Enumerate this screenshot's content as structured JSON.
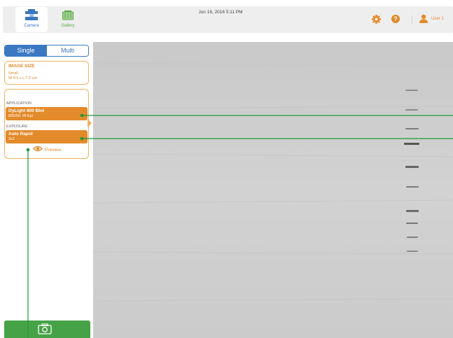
{
  "topbar": {
    "camera_label": "Camera",
    "gallery_label": "Gallery",
    "datetime": "Jun 16, 2016  5:11 PM",
    "user_label": "User 1",
    "help_glyph": "?"
  },
  "mode": {
    "single_label": "Single",
    "multi_label": "Multi",
    "selected": "Single"
  },
  "image_size": {
    "heading": "IMAGE SIZE",
    "size": "Small",
    "dimensions": "W 9.5 x L 7.6 cm"
  },
  "application": {
    "heading": "APPLICATION",
    "value": "DyLight 800 Blot",
    "detail": "835/50, IR Epi"
  },
  "exposure": {
    "heading": "EXPOSURE",
    "value": "Auto Rapid",
    "detail": "2x2"
  },
  "preview": {
    "label": "Preview"
  },
  "colors": {
    "accent_blue": "#3a78c2",
    "accent_orange": "#e38a2a",
    "accent_green": "#46a246",
    "callout_green": "#1a9a3a"
  },
  "icons": [
    "camera-mode-icon",
    "gallery-icon",
    "gear-icon",
    "help-icon",
    "user-icon",
    "eye-icon",
    "camera-icon"
  ]
}
